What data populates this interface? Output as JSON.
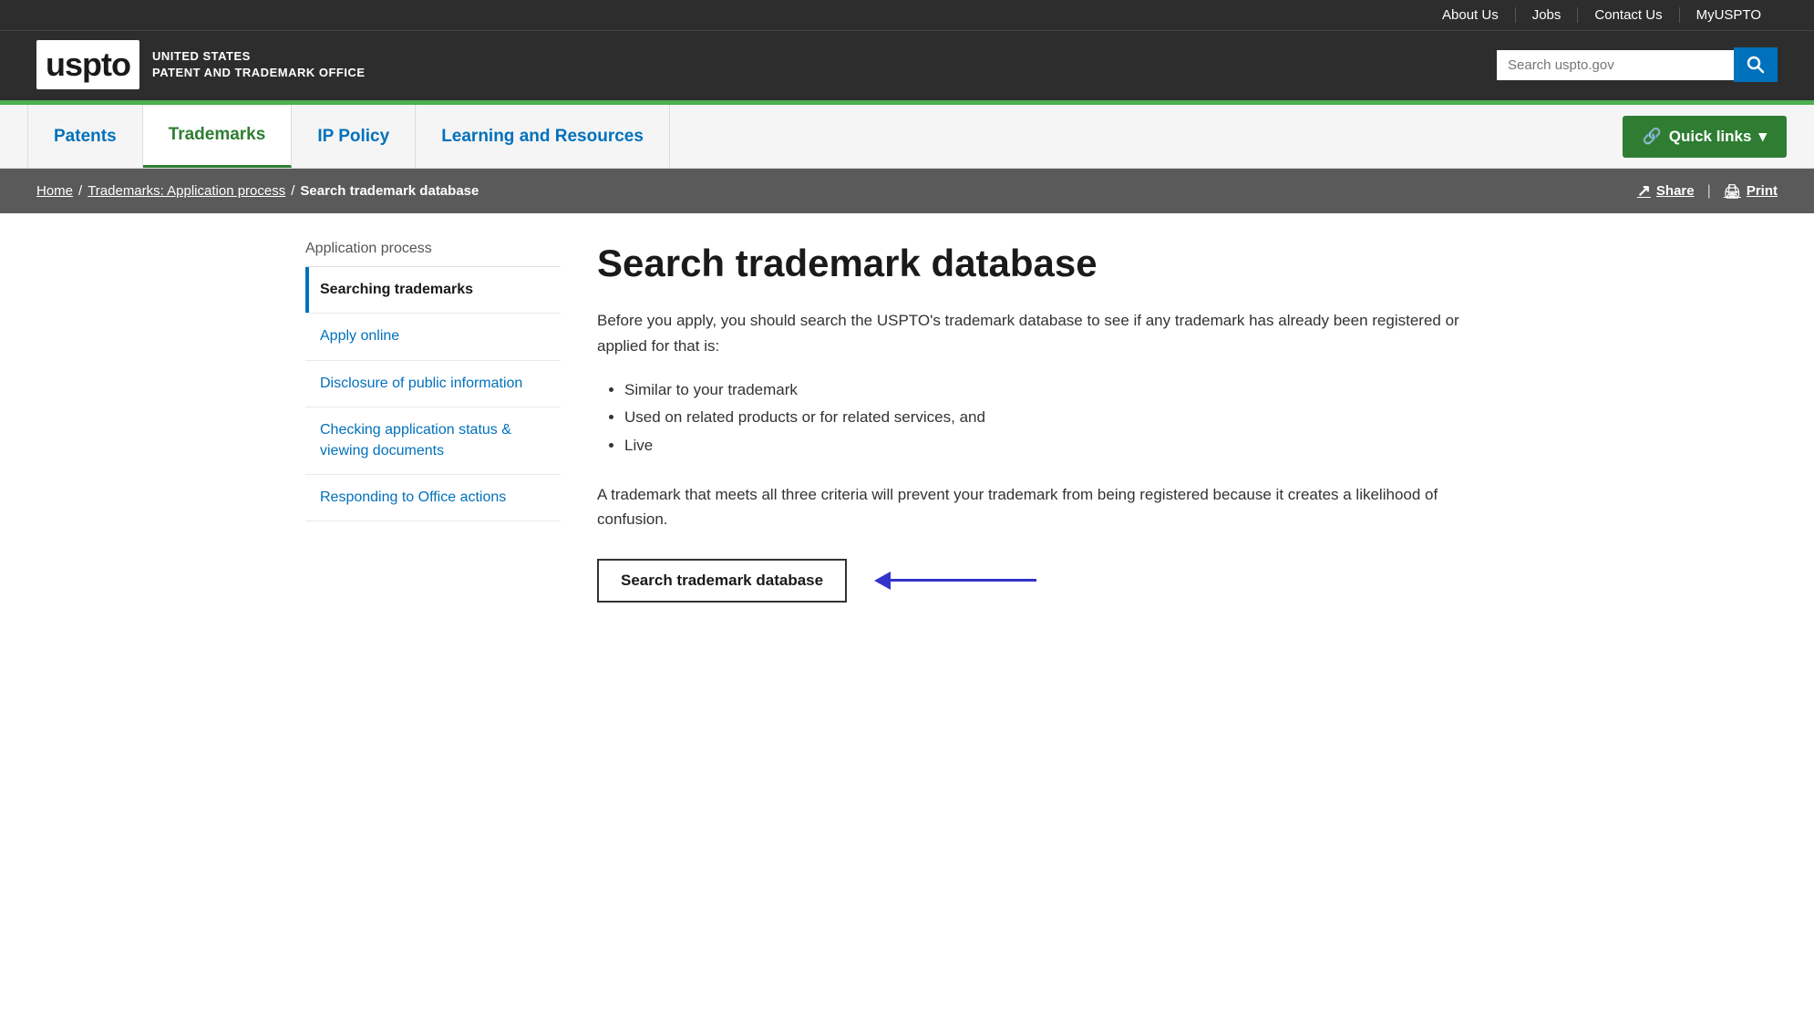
{
  "utility_bar": {
    "links": [
      {
        "label": "About Us",
        "url": "#"
      },
      {
        "label": "Jobs",
        "url": "#"
      },
      {
        "label": "Contact Us",
        "url": "#"
      },
      {
        "label": "MyUSPTO",
        "url": "#"
      }
    ]
  },
  "header": {
    "logo_text": "uspto",
    "tagline_line1": "UNITED STATES",
    "tagline_line2": "PATENT AND TRADEMARK OFFICE",
    "search_placeholder": "Search uspto.gov"
  },
  "nav": {
    "items": [
      {
        "label": "Patents",
        "active": false
      },
      {
        "label": "Trademarks",
        "active": true
      },
      {
        "label": "IP Policy",
        "active": false
      },
      {
        "label": "Learning and Resources",
        "active": false
      }
    ],
    "quick_links_label": "Quick links"
  },
  "breadcrumb": {
    "home": "Home",
    "parent": "Trademarks: Application process",
    "current": "Search trademark database",
    "share_label": "Share",
    "print_label": "Print"
  },
  "sidebar": {
    "title": "Application process",
    "items": [
      {
        "label": "Searching trademarks",
        "active": true
      },
      {
        "label": "Apply online",
        "active": false
      },
      {
        "label": "Disclosure of public information",
        "active": false
      },
      {
        "label": "Checking application status & viewing documents",
        "active": false
      },
      {
        "label": "Responding to Office actions",
        "active": false
      }
    ]
  },
  "main": {
    "page_title": "Search trademark database",
    "intro": "Before you apply, you should search the USPTO's trademark database to see if any trademark has already been registered or applied for that is:",
    "bullets": [
      "Similar to your trademark",
      "Used on related products or for related services, and",
      "Live"
    ],
    "conclusion": "A trademark that meets all three criteria will prevent your trademark from being registered because it creates a likelihood of confusion.",
    "search_button_label": "Search trademark database"
  }
}
